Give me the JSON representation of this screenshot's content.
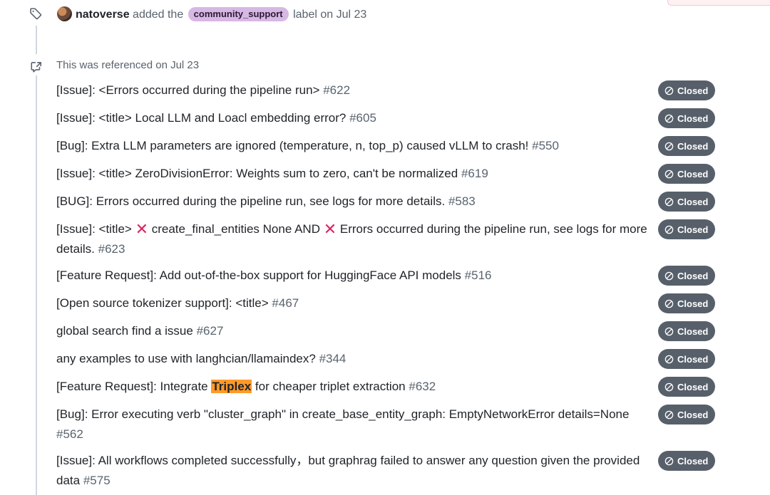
{
  "label_event": {
    "actor": "natoverse",
    "pre_text": " added the ",
    "label": "community_support",
    "post_text": " label on Jul 23",
    "label_color": "#d7b7e4"
  },
  "references": {
    "header": "This was referenced on Jul 23",
    "state_color": "#57606a",
    "items": [
      {
        "title": "[Issue]: <Errors occurred during the pipeline run>",
        "number": "#622",
        "state": "Closed"
      },
      {
        "title": "[Issue]: <title> Local LLM and Loacl embedding error?",
        "number": "#605",
        "state": "Closed"
      },
      {
        "title": "[Bug]: Extra LLM parameters are ignored (temperature, n, top_p) caused vLLM to crash!",
        "number": "#550",
        "state": "Closed"
      },
      {
        "title": "[Issue]: <title> ZeroDivisionError: Weights sum to zero, can't be normalized",
        "number": "#619",
        "state": "Closed"
      },
      {
        "title": "[BUG]: Errors occurred during the pipeline run, see logs for more details.",
        "number": "#583",
        "state": "Closed"
      },
      {
        "title_parts": [
          "[Issue]: <title> ",
          " create_final_entities None AND ",
          " Errors occurred during the pipeline run, see logs for more details."
        ],
        "x_glyph": "✕",
        "number": "#623",
        "state": "Closed"
      },
      {
        "title": "[Feature Request]: Add out-of-the-box support for HuggingFace API models",
        "number": "#516",
        "state": "Closed"
      },
      {
        "title": "[Open source tokenizer support]: <title>",
        "number": "#467",
        "state": "Closed"
      },
      {
        "title": "global search find a issue",
        "number": "#627",
        "state": "Closed"
      },
      {
        "title": "any examples to use with langhcian/llamaindex?",
        "number": "#344",
        "state": "Closed"
      },
      {
        "title_parts": [
          "[Feature Request]: Integrate ",
          "Triplex",
          " for cheaper triplet extraction"
        ],
        "highlight_color": "#ff9a28",
        "number": "#632",
        "state": "Closed"
      },
      {
        "title": "[Bug]: Error executing verb \"cluster_graph\" in create_base_entity_graph: EmptyNetworkError details=None",
        "number": "#562",
        "state": "Closed"
      },
      {
        "title": "[Issue]: All workflows completed successfully，but graphrag failed to answer any question given the provided data",
        "number": "#575",
        "state": "Closed"
      }
    ]
  }
}
